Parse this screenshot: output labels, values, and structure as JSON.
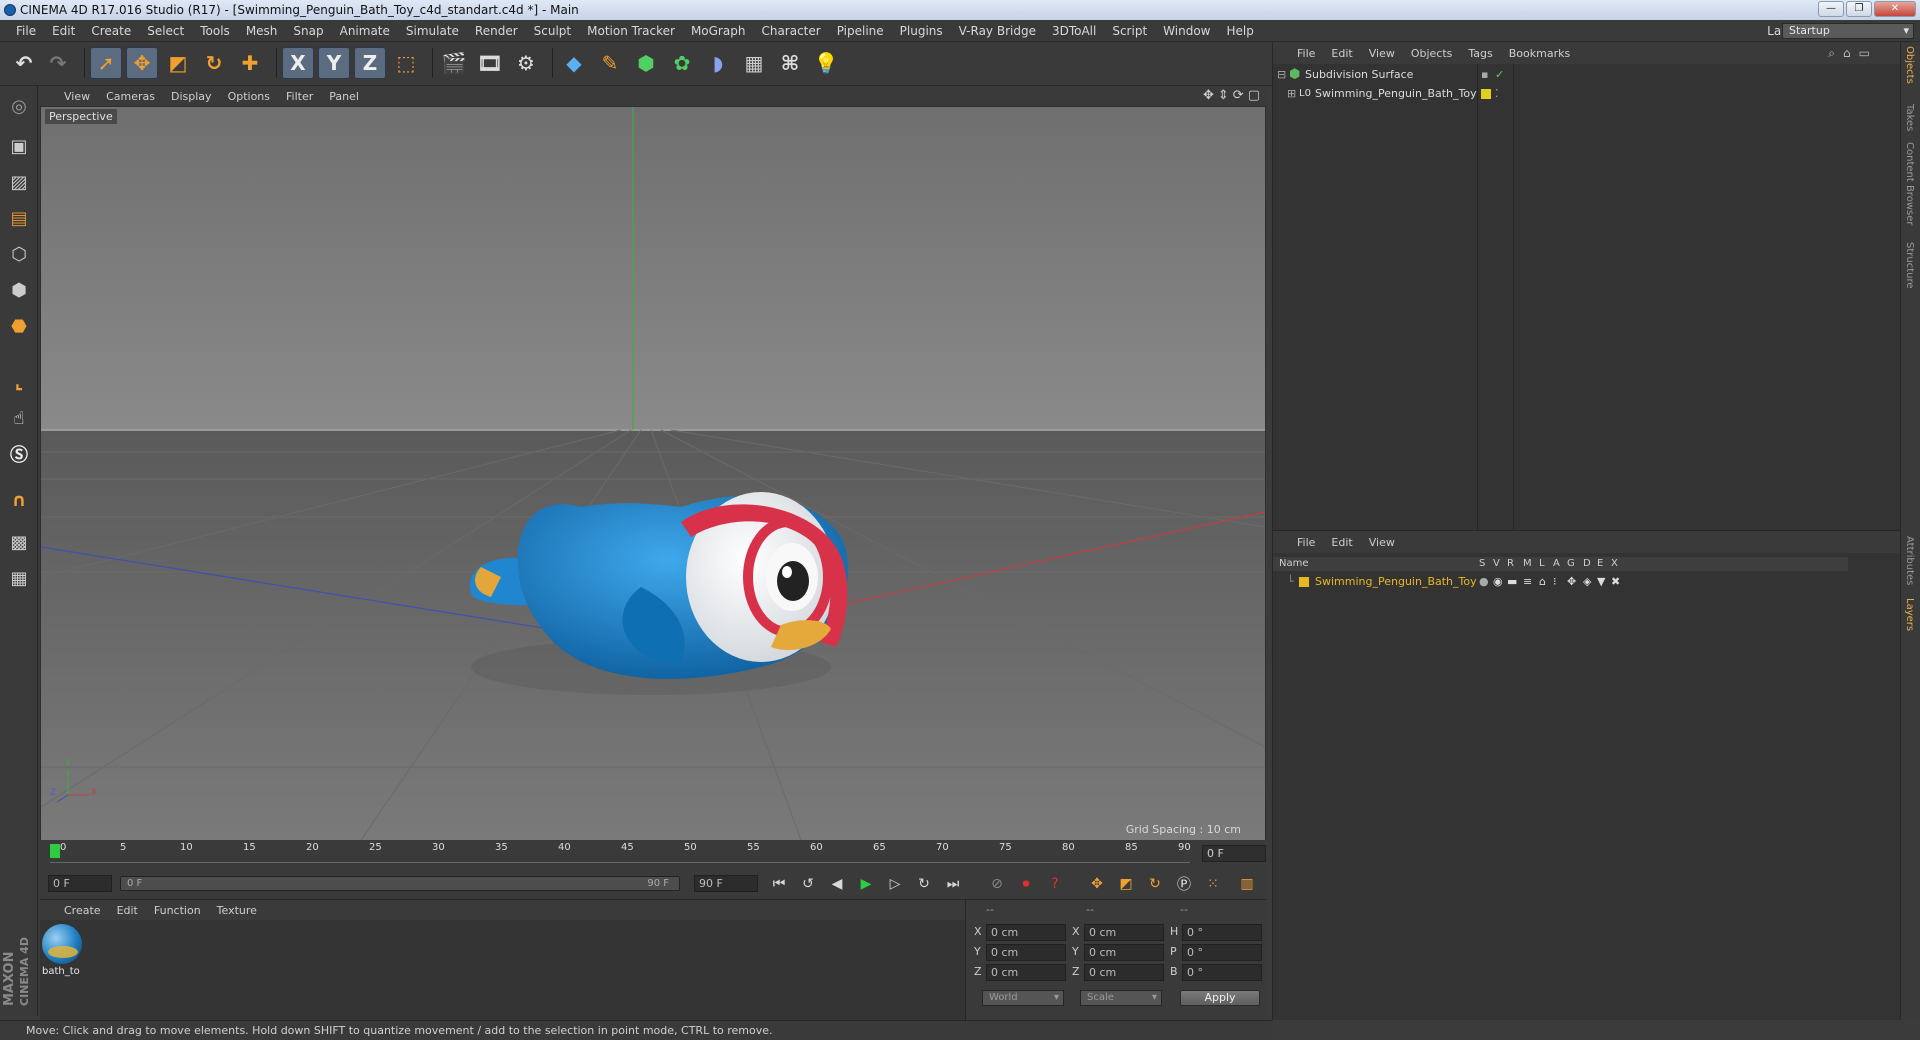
{
  "window": {
    "title": "CINEMA 4D R17.016 Studio (R17) - [Swimming_Penguin_Bath_Toy_c4d_standart.c4d *] - Main",
    "controls": [
      "—",
      "❐",
      "✕"
    ]
  },
  "menubar": {
    "items": [
      "File",
      "Edit",
      "Create",
      "Select",
      "Tools",
      "Mesh",
      "Snap",
      "Animate",
      "Simulate",
      "Render",
      "Sculpt",
      "Motion Tracker",
      "MoGraph",
      "Character",
      "Pipeline",
      "Plugins",
      "V-Ray Bridge",
      "3DToAll",
      "Script",
      "Window",
      "Help"
    ],
    "layout_label": "Layout:",
    "layout_value": "Startup"
  },
  "toolbar": {
    "axis_x": "X",
    "axis_y": "Y",
    "axis_z": "Z"
  },
  "viewport": {
    "menu": [
      "View",
      "Cameras",
      "Display",
      "Options",
      "Filter",
      "Panel"
    ],
    "camera_label": "Perspective",
    "grid_spacing": "Grid Spacing : 10 cm",
    "axis_labels": {
      "y": "Y",
      "z": "Z",
      "x": "X"
    }
  },
  "timeline": {
    "ticks": [
      "0",
      "5",
      "10",
      "15",
      "20",
      "25",
      "30",
      "35",
      "40",
      "45",
      "50",
      "55",
      "60",
      "65",
      "70",
      "75",
      "80",
      "85",
      "90"
    ],
    "current_frame": "0 F"
  },
  "transport": {
    "start_field": "0 F",
    "range_start": "0 F",
    "range_end": "90 F",
    "end_field": "90 F"
  },
  "materials": {
    "menu": [
      "Create",
      "Edit",
      "Function",
      "Texture"
    ],
    "items": [
      {
        "name": "bath_to"
      }
    ]
  },
  "coordinates": {
    "headers": [
      "--",
      "--",
      "--"
    ],
    "rows": [
      {
        "pos_label": "X",
        "pos": "0 cm",
        "size_label": "X",
        "size": "0 cm",
        "rot_label": "H",
        "rot": "0 °"
      },
      {
        "pos_label": "Y",
        "pos": "0 cm",
        "size_label": "Y",
        "size": "0 cm",
        "rot_label": "P",
        "rot": "0 °"
      },
      {
        "pos_label": "Z",
        "pos": "0 cm",
        "size_label": "Z",
        "size": "0 cm",
        "rot_label": "B",
        "rot": "0 °"
      }
    ],
    "mode": "World",
    "transform": "Scale",
    "apply": "Apply"
  },
  "status": {
    "text": "Move: Click and drag to move elements. Hold down SHIFT to quantize movement / add to the selection in point mode, CTRL to remove."
  },
  "object_manager": {
    "menu": [
      "File",
      "Edit",
      "View",
      "Objects",
      "Tags",
      "Bookmarks"
    ],
    "objects": [
      {
        "name": "Subdivision Surface",
        "color": "#5fb85f"
      },
      {
        "name": "Swimming_Penguin_Bath_Toy",
        "color": "#e0d020"
      }
    ]
  },
  "layer_manager": {
    "menu": [
      "File",
      "Edit",
      "View"
    ],
    "columns": [
      "Name",
      "S",
      "V",
      "R",
      "M",
      "L",
      "A",
      "G",
      "D",
      "E",
      "X"
    ],
    "layers": [
      {
        "name": "Swimming_Penguin_Bath_Toy",
        "color": "#e8b820"
      }
    ]
  },
  "side_tabs": [
    "Objects",
    "Takes",
    "Content Browser",
    "Structure",
    "Attributes",
    "Layers"
  ],
  "branding": {
    "logo_text_1": "MAXON",
    "logo_text_2": "CINEMA 4D"
  },
  "colors": {
    "accent": "#5b6b80",
    "layer_text": "#e8b820",
    "active_tab": "#e8b04a"
  }
}
